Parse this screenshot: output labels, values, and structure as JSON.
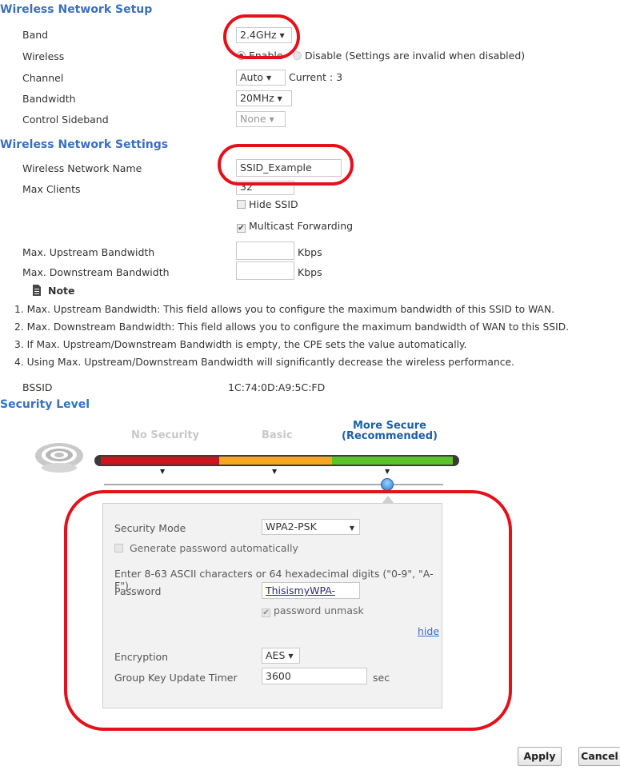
{
  "wireless_setup": {
    "title": "Wireless Network Setup",
    "band_label": "Band",
    "band_value": "2.4GHz",
    "wireless_label": "Wireless",
    "enable_label": "Enable",
    "disable_label": "Disable (Settings are invalid when disabled)",
    "channel_label": "Channel",
    "channel_value": "Auto",
    "channel_current": "Current : 3",
    "bandwidth_label": "Bandwidth",
    "bandwidth_value": "20MHz",
    "sideband_label": "Control Sideband",
    "sideband_value": "None"
  },
  "wireless_settings": {
    "title": "Wireless Network Settings",
    "name_label": "Wireless Network Name",
    "name_value": "SSID_Example",
    "max_clients_label": "Max Clients",
    "max_clients_value": "32",
    "hide_ssid_label": "Hide SSID",
    "multicast_label": "Multicast Forwarding",
    "upstream_label": "Max. Upstream Bandwidth",
    "downstream_label": "Max. Downstream Bandwidth",
    "unit": "Kbps",
    "upstream_value": "",
    "downstream_value": ""
  },
  "note": {
    "title": "Note",
    "lines": [
      "1. Max. Upstream Bandwidth: This field allows you to configure the maximum bandwidth of this SSID to WAN.",
      "2. Max. Downstream Bandwidth: This field allows you to configure the maximum bandwidth of WAN to this SSID.",
      "3. If Max. Upstream/Downstream Bandwidth is empty, the CPE sets the value automatically.",
      "4. Using Max. Upstream/Downstream Bandwidth will significantly decrease the wireless performance."
    ]
  },
  "bssid": {
    "label": "BSSID",
    "value": "1C:74:0D:A9:5C:FD"
  },
  "security_level": {
    "title": "Security Level",
    "levels": [
      "No Security",
      "Basic",
      "More Secure",
      "(Recommended)"
    ],
    "slider_colors": [
      "#c8161d",
      "#f5a623",
      "#5cc22b"
    ]
  },
  "security_panel": {
    "mode_label": "Security Mode",
    "mode_value": "WPA2-PSK",
    "generate_label": "Generate password automatically",
    "hint": "Enter 8-63 ASCII characters or 64 hexadecimal digits (\"0-9\", \"A-F\").",
    "password_label": "Password",
    "password_value": "ThisismyWPA-PSKpre",
    "unmask_label": "password unmask",
    "hide_link": "hide",
    "encryption_label": "Encryption",
    "encryption_value": "AES",
    "timer_label": "Group Key Update Timer",
    "timer_value": "3600",
    "timer_unit": "sec"
  },
  "buttons": {
    "apply": "Apply",
    "cancel": "Cancel"
  },
  "highlight_color": "#e4111b"
}
